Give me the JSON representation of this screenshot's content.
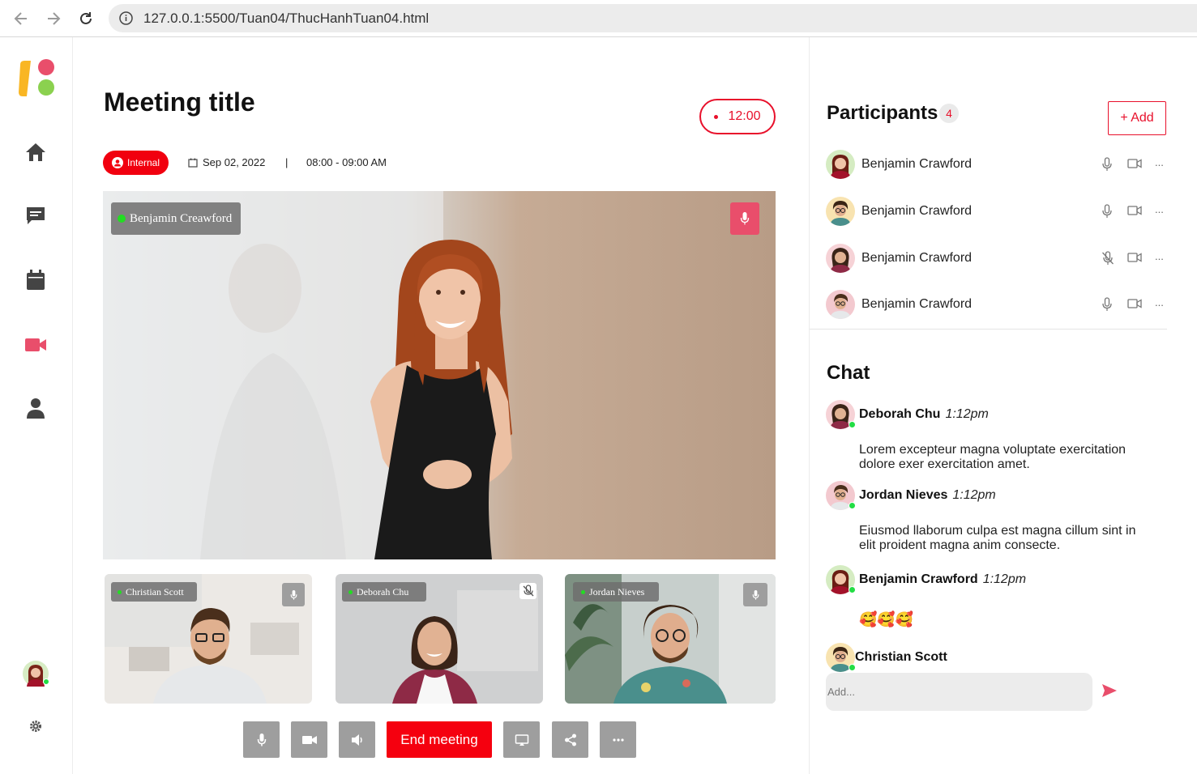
{
  "browser": {
    "url": "127.0.0.1:5500/Tuan04/ThucHanhTuan04.html",
    "icons": [
      "back-arrow-icon",
      "forward-arrow-icon",
      "reload-icon",
      "info-icon"
    ]
  },
  "sidebar": {
    "icons": [
      "app-logo-icon",
      "home-icon",
      "chat-icon",
      "calendar-icon",
      "video-icon",
      "user-icon",
      "avatar",
      "settings-icon"
    ],
    "active": "video-icon"
  },
  "meeting": {
    "title": "Meeting title",
    "timer": "12:00",
    "badge": "Internal",
    "date": "Sep 02, 2022",
    "separator": "|",
    "time": "08:00 - 09:00 AM"
  },
  "main_video": {
    "name": "Benjamin Creawford"
  },
  "thumbnails": [
    {
      "name": "Christian Scott",
      "mic": "on"
    },
    {
      "name": "Deborah Chu",
      "mic": "off"
    },
    {
      "name": "Jordan Nieves",
      "mic": "on"
    }
  ],
  "controls": {
    "end_label": "End meeting",
    "icons": [
      "mic-icon",
      "camera-icon",
      "speaker-icon",
      "screen-share-icon",
      "share-icon",
      "more-icon"
    ]
  },
  "participants": {
    "title": "Participants",
    "count": "4",
    "add_label": "+ Add",
    "items": [
      {
        "name": "Benjamin Crawford",
        "mic": "on"
      },
      {
        "name": "Benjamin Crawford",
        "mic": "on"
      },
      {
        "name": "Benjamin Crawford",
        "mic": "off"
      },
      {
        "name": "Benjamin Crawford",
        "mic": "on"
      }
    ],
    "more": "..."
  },
  "chat": {
    "title": "Chat",
    "messages": [
      {
        "name": "Deborah Chu",
        "time": "1:12pm",
        "text": "Lorem excepteur magna voluptate exercitation dolore exer exercitation amet."
      },
      {
        "name": "Jordan Nieves",
        "time": "1:12pm",
        "text": "Eiusmod llaborum culpa est magna cillum sint in elit proident magna anim consecte."
      },
      {
        "name": "Benjamin Crawford",
        "time": "1:12pm",
        "text": "🥰🥰🥰"
      },
      {
        "name": "Christian Scott",
        "time": "",
        "text": ""
      }
    ],
    "input_placeholder": "Add..."
  },
  "colors": {
    "accent": "#e8102b",
    "logo_yellow": "#f9b624",
    "logo_pink": "#e94e6b",
    "logo_green": "#8bd14f",
    "control_gray": "#9e9e9e"
  }
}
